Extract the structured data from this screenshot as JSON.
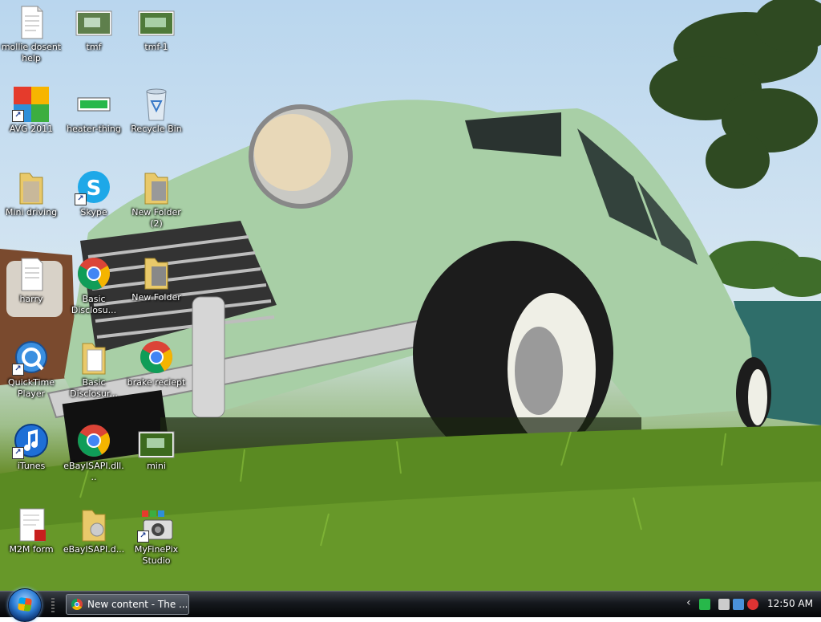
{
  "desktop": {
    "icons": [
      {
        "name": "mollie-dosent-help",
        "label": "mollie dosent help",
        "kind": "document"
      },
      {
        "name": "tmf",
        "label": "tmf",
        "kind": "image"
      },
      {
        "name": "tmf-1",
        "label": "tmf-1",
        "kind": "image"
      },
      {
        "name": "avg-2011",
        "label": "AVG 2011",
        "kind": "avg"
      },
      {
        "name": "heater-thing",
        "label": "heater-thing",
        "kind": "battery"
      },
      {
        "name": "recycle-bin",
        "label": "Recycle Bin",
        "kind": "recycle"
      },
      {
        "name": "mini-driving",
        "label": "Mini driving",
        "kind": "folder"
      },
      {
        "name": "skype",
        "label": "Skype",
        "kind": "skype"
      },
      {
        "name": "new-folder-2",
        "label": "New Folder (2)",
        "kind": "folder"
      },
      {
        "name": "harry",
        "label": "harry",
        "kind": "document"
      },
      {
        "name": "basic-disclosu-1",
        "label": "Basic Disclosu...",
        "kind": "chrome"
      },
      {
        "name": "new-folder",
        "label": "New Folder",
        "kind": "folder"
      },
      {
        "name": "quicktime-player",
        "label": "QuickTime Player",
        "kind": "quicktime"
      },
      {
        "name": "basic-disclosur",
        "label": "Basic Disclosur...",
        "kind": "folder"
      },
      {
        "name": "brake-reciept",
        "label": "brake reciept",
        "kind": "chrome"
      },
      {
        "name": "itunes",
        "label": "iTunes",
        "kind": "itunes"
      },
      {
        "name": "ebayisapi-dll",
        "label": "eBayISAPI.dll...",
        "kind": "chrome"
      },
      {
        "name": "mini",
        "label": "mini",
        "kind": "image"
      },
      {
        "name": "m2m-form",
        "label": "M2M form",
        "kind": "pdf"
      },
      {
        "name": "ebayisapi-d",
        "label": "eBayISAPI.d...",
        "kind": "folder"
      },
      {
        "name": "myfinepix-studio",
        "label": "MyFinePix Studio",
        "kind": "camera"
      }
    ]
  },
  "taskbar": {
    "task_label": "New content - The ...",
    "tray_expand": "‹",
    "clock": "12:50 AM"
  },
  "colors": {
    "car_body": "#a8cfa6",
    "sky": "#c6dcef",
    "grass": "#5a8a22",
    "taskbar": "#15181d"
  }
}
